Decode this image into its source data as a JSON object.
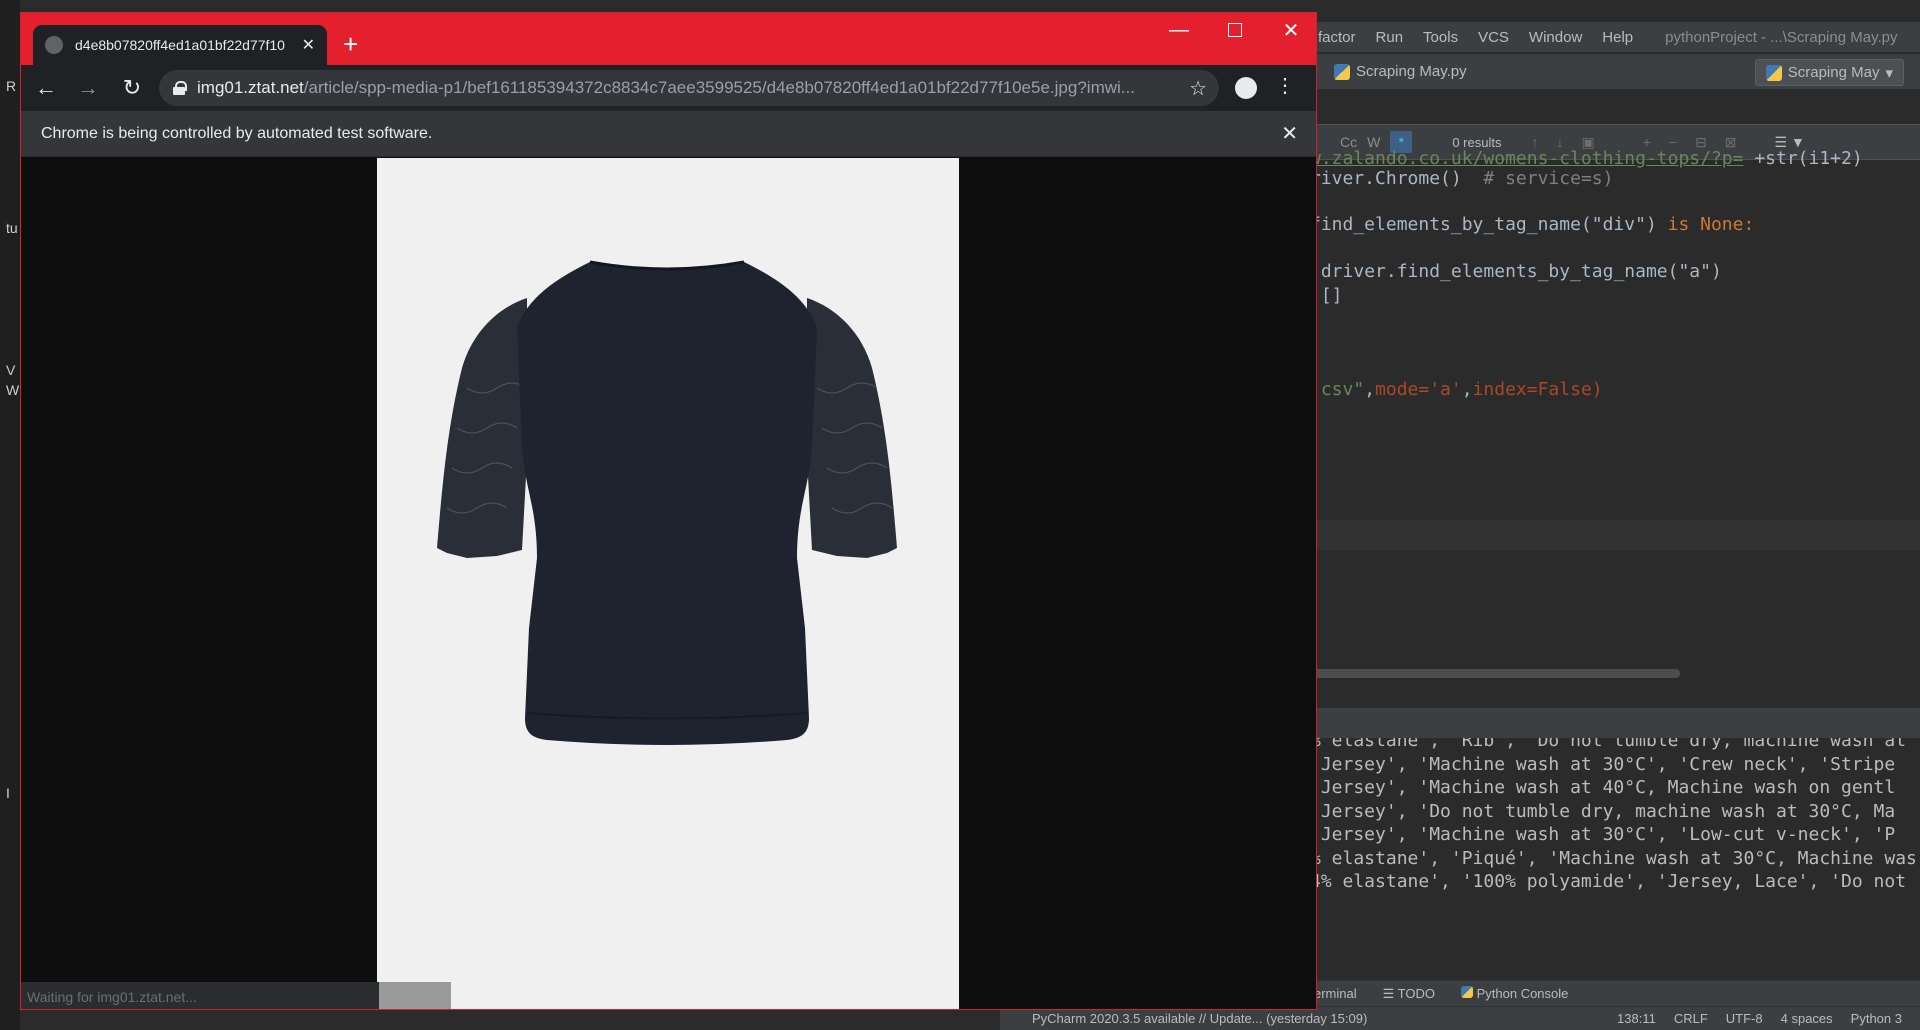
{
  "ide": {
    "menu": [
      "factor",
      "Run",
      "Tools",
      "VCS",
      "Window",
      "Help"
    ],
    "project_title": "pythonProject - ...\\Scraping May.py",
    "nav_file": "Scraping May.py",
    "run_config": "Scraping May",
    "find": {
      "case_token": "Cc",
      "word_token": "W",
      "regex_token": "*",
      "results": "0 results"
    },
    "code_lines": [
      "w.zalando.co.uk/womens-clothing-tops/?p=",
      "river.Chrome()",
      "# service=s)",
      "find_elements_by_tag_name(\"div\")",
      "is None:",
      "driver.find_elements_by_tag_name(\"a\")",
      "[]",
      ")",
      ".csv\"",
      "mode='a'",
      "index=False)"
    ],
    "console_lines": [
      "% elastane', 'Rib', 'Do not tumble dry, machine wash at",
      "'Jersey', 'Machine wash at 30°C', 'Crew neck', 'Stripe",
      "'Jersey', 'Machine wash at 40°C, Machine wash on gentl",
      "'Jersey', 'Do not tumble dry, machine wash at 30°C, Ma",
      "'Jersey', 'Machine wash at 30°C', 'Low-cut v-neck', 'P",
      "% elastane', 'Piqué', 'Machine wash at 30°C, Machine was",
      "4% elastane', '100% polyamide', 'Jersey, Lace', 'Do not"
    ],
    "tool_windows": [
      "erminal",
      "TODO",
      "Python Console"
    ],
    "status": {
      "message": "PyCharm 2020.3.5 available // Update... (yesterday 15:09)",
      "position": "138:11",
      "line_sep": "CRLF",
      "encoding": "UTF-8",
      "indent": "4 spaces",
      "interpreter": "Python 3"
    }
  },
  "desktop_left_chars": [
    "R",
    "tu",
    "V",
    "W",
    "I"
  ],
  "browser": {
    "tab_title": "d4e8b07820ff4ed1a01bf22d77f10",
    "new_tab": "+",
    "url_host": "img01.ztat.net",
    "url_path": "/article/spp-media-p1/bef161185394372c8834c7aee3599525/d4e8b07820ff4ed1a01bf22d77f10e5e.jpg?imwi...",
    "infobar_text": "Chrome is being controlled by automated test software.",
    "status_text": "Waiting for img01.ztat.net...",
    "accent_color": "#e5202e"
  },
  "product_image": {
    "subject": "navy-blue-top-with-lace-short-sleeves",
    "garment_color": "#1f2330",
    "lace_color": "#2a2e38",
    "backdrop_color": "#f0f0f0"
  }
}
